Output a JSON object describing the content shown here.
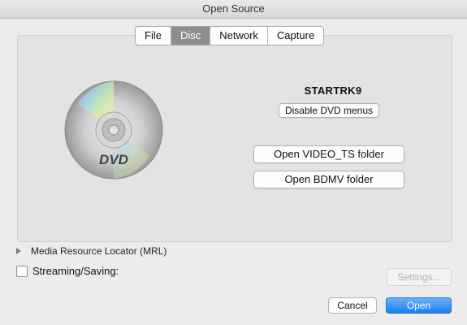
{
  "window": {
    "title": "Open Source"
  },
  "tabs": [
    {
      "label": "File"
    },
    {
      "label": "Disc",
      "active": true
    },
    {
      "label": "Network"
    },
    {
      "label": "Capture"
    }
  ],
  "disc": {
    "icon": "dvd-disc-icon",
    "logo_text": "DVD",
    "name": "STARTRK9",
    "disable_menus_label": "Disable DVD menus",
    "open_video_ts_label": "Open VIDEO_TS folder",
    "open_bdmv_label": "Open BDMV folder"
  },
  "mrl": {
    "label": "Media Resource Locator (MRL)",
    "icon": "disclosure-triangle-icon"
  },
  "streaming": {
    "label": "Streaming/Saving:",
    "checked": false,
    "settings_label": "Settings..."
  },
  "footer": {
    "cancel_label": "Cancel",
    "open_label": "Open"
  },
  "colors": {
    "accent": "#1c7ef1",
    "active_tab": "#8e8e8e"
  }
}
